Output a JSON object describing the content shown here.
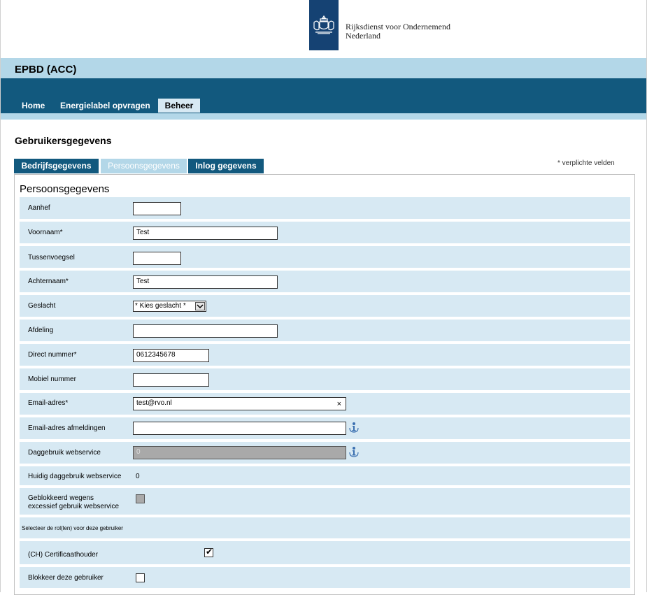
{
  "header": {
    "org_name_line1": "Rijksdienst voor Ondernemend",
    "org_name_line2": "Nederland",
    "app_title": "EPBD (ACC)"
  },
  "nav": {
    "home": "Home",
    "energielabel": "Energielabel opvragen",
    "beheer": "Beheer"
  },
  "page_title": "Gebruikersgegevens",
  "tabs": {
    "bedrijf": "Bedrijfsgegevens",
    "persoon": "Persoonsgegevens",
    "inlog": "Inlog gegevens"
  },
  "required_note": "* verplichte velden",
  "section_title": "Persoonsgegevens",
  "fields": {
    "aanhef": {
      "label": "Aanhef",
      "value": ""
    },
    "voornaam": {
      "label": "Voornaam*",
      "value": "Test"
    },
    "tussenvoegsel": {
      "label": "Tussenvoegsel",
      "value": ""
    },
    "achternaam": {
      "label": "Achternaam*",
      "value": "Test"
    },
    "geslacht": {
      "label": "Geslacht",
      "value": "* Kies geslacht *"
    },
    "afdeling": {
      "label": "Afdeling",
      "value": ""
    },
    "direct_nummer": {
      "label": "Direct nummer*",
      "value": "0612345678"
    },
    "mobiel_nummer": {
      "label": "Mobiel nummer",
      "value": ""
    },
    "email": {
      "label": "Email-adres*",
      "value": "test@rvo.nl",
      "clear": "×"
    },
    "email_afmeldingen": {
      "label": "Email-adres afmeldingen",
      "value": ""
    },
    "daggebruik": {
      "label": "Daggebruik webservice",
      "value": "0"
    },
    "huidig_daggebruik": {
      "label": "Huidig daggebruik webservice",
      "value": "0"
    },
    "geblokkeerd": {
      "label_line1": "Geblokkeerd wegens",
      "label_line2": "excessief gebruik webservice"
    },
    "rollen_label": "Selecteer de rol(len) voor deze gebruiker",
    "certificaathouder": {
      "label": "(CH) Certificaathouder",
      "checked": true
    },
    "blokkeer": {
      "label": "Blokkeer deze gebruiker",
      "checked": false
    }
  },
  "colors": {
    "navy": "#154273",
    "nav_blue": "#12597e",
    "light_blue": "#b3d7e8",
    "row_blue": "#d7e9f3"
  }
}
